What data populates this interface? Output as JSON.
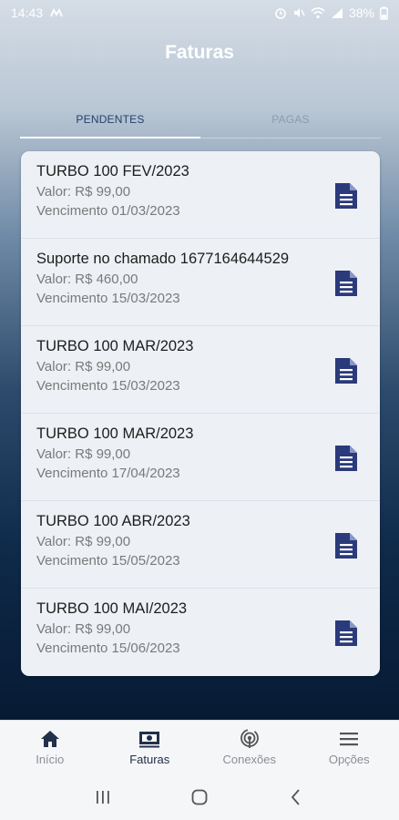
{
  "status_bar": {
    "time": "14:43",
    "battery": "38%",
    "icons": [
      "app-notification-icon",
      "alarm-icon",
      "mute-icon",
      "wifi-icon",
      "signal-icon",
      "battery-icon"
    ]
  },
  "header": {
    "title": "Faturas"
  },
  "tabs": [
    {
      "label": "PENDENTES",
      "active": true
    },
    {
      "label": "PAGAS",
      "active": false
    }
  ],
  "invoices": [
    {
      "title": "TURBO 100 FEV/2023",
      "valor": "Valor: R$ 99,00",
      "vencimento": "Vencimento 01/03/2023"
    },
    {
      "title": "Suporte no chamado 1677164644529",
      "valor": "Valor: R$ 460,00",
      "vencimento": "Vencimento 15/03/2023"
    },
    {
      "title": "TURBO 100 MAR/2023",
      "valor": "Valor: R$ 99,00",
      "vencimento": "Vencimento 15/03/2023"
    },
    {
      "title": "TURBO 100 MAR/2023",
      "valor": "Valor: R$ 99,00",
      "vencimento": "Vencimento 17/04/2023"
    },
    {
      "title": "TURBO 100 ABR/2023",
      "valor": "Valor: R$ 99,00",
      "vencimento": "Vencimento 15/05/2023"
    },
    {
      "title": "TURBO 100 MAI/2023",
      "valor": "Valor: R$ 99,00",
      "vencimento": "Vencimento 15/06/2023"
    }
  ],
  "bottom_nav": [
    {
      "label": "Início",
      "icon": "home-icon",
      "active": false
    },
    {
      "label": "Faturas",
      "icon": "invoice-icon",
      "active": true
    },
    {
      "label": "Conexões",
      "icon": "connection-icon",
      "active": false
    },
    {
      "label": "Opções",
      "icon": "menu-icon",
      "active": false
    }
  ],
  "colors": {
    "accent": "#2b3a7a",
    "nav_active": "#22304a"
  }
}
